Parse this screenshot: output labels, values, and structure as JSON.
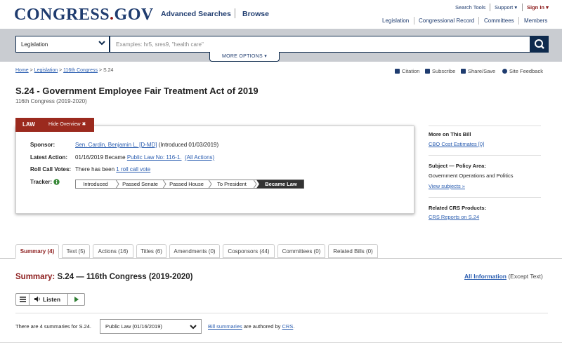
{
  "header": {
    "logo_main": "CONGRESS",
    "logo_dot": ".",
    "logo_tld": "GOV",
    "advanced_searches": "Advanced Searches",
    "browse": "Browse",
    "search_tools": "Search Tools",
    "support": "Support ▾",
    "sign_in": "Sign In ▾",
    "nav": [
      "Legislation",
      "Congressional Record",
      "Committees",
      "Members"
    ]
  },
  "search": {
    "scope": "Legislation",
    "placeholder": "Examples: hr5, sres9, \"health care\"",
    "more_options": "MORE OPTIONS ▾"
  },
  "breadcrumb": {
    "home": "Home",
    "sep": " > ",
    "legislation": "Legislation",
    "congress": "116th Congress",
    "current": "S.24"
  },
  "tools": [
    "Citation",
    "Subscribe",
    "Share/Save",
    "Site Feedback"
  ],
  "bill": {
    "title": "S.24 - Government Employee Fair Treatment Act of 2019",
    "congress": "116th Congress (2019-2020)"
  },
  "overview": {
    "status_label": "LAW",
    "hide_overview": "Hide Overview ✖",
    "sponsor_label": "Sponsor:",
    "sponsor_name": "Sen. Cardin, Benjamin L. [D-MD]",
    "sponsor_intro": "(Introduced 01/03/2019)",
    "latest_action_label": "Latest Action:",
    "latest_action_text": "01/16/2019 Became",
    "latest_action_link": "Public Law No: 116-1.",
    "all_actions": "(All Actions)",
    "roll_call_label": "Roll Call Votes:",
    "roll_call_text": "There has been",
    "roll_call_link": "1 roll call vote",
    "tracker_label": "Tracker:",
    "tracker_steps": [
      "Introduced",
      "Passed Senate",
      "Passed House",
      "To President",
      "Became Law"
    ],
    "tracker_current": "Became Law"
  },
  "sidebar": {
    "more_heading": "More on This Bill",
    "cbo_link": "CBO Cost Estimates [0]",
    "subject_heading": "Subject — Policy Area:",
    "subject_value": "Government Operations and Politics",
    "view_subjects": "View subjects »",
    "crs_heading": "Related CRS Products:",
    "crs_link": "CRS Reports on S.24"
  },
  "tabs": [
    "Summary (4)",
    "Text (5)",
    "Actions (16)",
    "Titles (6)",
    "Amendments (0)",
    "Cosponsors (44)",
    "Committees (0)",
    "Related Bills (0)"
  ],
  "summary": {
    "title_prefix": "Summary:",
    "title_rest": " S.24 — 116th Congress (2019-2020)",
    "all_information": "All Information",
    "except_text": " (Except Text)",
    "listen": "Listen",
    "count_text": "There are 4 summaries for S.24.",
    "selected_version": "Public Law (01/16/2019)",
    "bill_summaries": "Bill summaries",
    "authored_mid": " are authored by ",
    "crs": "CRS",
    "period": "."
  },
  "colors": {
    "navy": "#1f3c6f",
    "dark_navy": "#0e2a4d",
    "law_red": "#9b2a1e",
    "link_blue": "#2a5db0",
    "band_gray": "#c9ccd1"
  }
}
